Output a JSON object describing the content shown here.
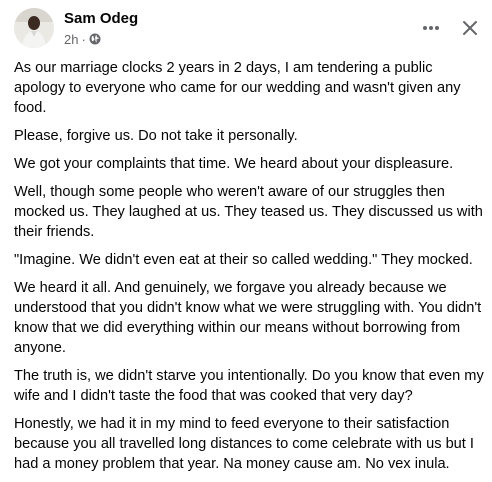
{
  "post": {
    "author": "Sam Odeg",
    "time": "2h",
    "separator": "·",
    "audience_icon": "globe-icon",
    "more_icon": "more-options-icon",
    "close_icon": "close-icon",
    "paragraphs": [
      "As our marriage clocks 2 years in 2 days, I am tendering a public apology to everyone who came for our wedding and wasn't given any food.",
      "Please, forgive us. Do not take it personally.",
      "We got your complaints that time. We heard about your displeasure.",
      "Well, though some people who weren't aware of our struggles then mocked us. They laughed at us. They teased us. They discussed us with their friends.",
      "\"Imagine. We didn't even eat at their so called wedding.\" They mocked.",
      "We heard it all. And genuinely, we forgave you already because we understood that you didn't know what we were struggling with. You didn't know that we did everything within our means without borrowing from anyone.",
      "The truth is, we didn't starve you intentionally. Do you know that even my wife and I didn't taste the food that was cooked that very day?",
      "Honestly, we had it in my mind to feed everyone to their satisfaction because you all travelled long distances to come celebrate with us but I had a money problem that year. Na money cause am. No vex inula."
    ]
  },
  "colors": {
    "text": "#050505",
    "secondary_text": "#65676b",
    "background": "#ffffff"
  }
}
